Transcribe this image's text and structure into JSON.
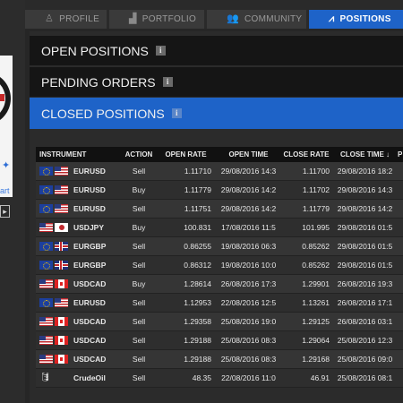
{
  "left": {
    "link_fragment": "art",
    "arrow_glyph": "▸"
  },
  "tabs": [
    {
      "label": "PROFILE",
      "icon": "profile-icon"
    },
    {
      "label": "PORTFOLIO",
      "icon": "portfolio-chart-icon"
    },
    {
      "label": "COMMUNITY",
      "icon": "community-icon"
    },
    {
      "label": "POSITIONS",
      "icon": "positions-icon",
      "active": true
    }
  ],
  "sections": {
    "open": "OPEN POSITIONS",
    "pending": "PENDING ORDERS",
    "closed": "CLOSED POSITIONS"
  },
  "info_glyph": "i",
  "table": {
    "headers": [
      "INSTRUMENT",
      "ACTION",
      "OPEN RATE",
      "OPEN TIME",
      "CLOSE RATE",
      "CLOSE TIME ↓",
      "P"
    ],
    "rows": [
      {
        "flags": [
          "eu",
          "us"
        ],
        "symbol": "EURUSD",
        "action": "Sell",
        "open_rate": "1.11710",
        "open_time": "29/08/2016 14:3",
        "close_rate": "1.11700",
        "close_time": "29/08/2016 18:2"
      },
      {
        "flags": [
          "eu",
          "us"
        ],
        "symbol": "EURUSD",
        "action": "Buy",
        "open_rate": "1.11779",
        "open_time": "29/08/2016 14:2",
        "close_rate": "1.11702",
        "close_time": "29/08/2016 14:3"
      },
      {
        "flags": [
          "eu",
          "us"
        ],
        "symbol": "EURUSD",
        "action": "Sell",
        "open_rate": "1.11751",
        "open_time": "29/08/2016 14:2",
        "close_rate": "1.11779",
        "close_time": "29/08/2016 14:2"
      },
      {
        "flags": [
          "us",
          "jp"
        ],
        "symbol": "USDJPY",
        "action": "Buy",
        "open_rate": "100.831",
        "open_time": "17/08/2016 11:5",
        "close_rate": "101.995",
        "close_time": "29/08/2016 01:5"
      },
      {
        "flags": [
          "eu",
          "gb"
        ],
        "symbol": "EURGBP",
        "action": "Sell",
        "open_rate": "0.86255",
        "open_time": "19/08/2016 06:3",
        "close_rate": "0.85262",
        "close_time": "29/08/2016 01:5"
      },
      {
        "flags": [
          "eu",
          "gb"
        ],
        "symbol": "EURGBP",
        "action": "Sell",
        "open_rate": "0.86312",
        "open_time": "19/08/2016 10:0",
        "close_rate": "0.85262",
        "close_time": "29/08/2016 01:5"
      },
      {
        "flags": [
          "us",
          "ca"
        ],
        "symbol": "USDCAD",
        "action": "Buy",
        "open_rate": "1.28614",
        "open_time": "26/08/2016 17:3",
        "close_rate": "1.29901",
        "close_time": "26/08/2016 19:3"
      },
      {
        "flags": [
          "eu",
          "us"
        ],
        "symbol": "EURUSD",
        "action": "Sell",
        "open_rate": "1.12953",
        "open_time": "22/08/2016 12:5",
        "close_rate": "1.13261",
        "close_time": "26/08/2016 17:1"
      },
      {
        "flags": [
          "us",
          "ca"
        ],
        "symbol": "USDCAD",
        "action": "Sell",
        "open_rate": "1.29358",
        "open_time": "25/08/2016 19:0",
        "close_rate": "1.29125",
        "close_time": "26/08/2016 03:1"
      },
      {
        "flags": [
          "us",
          "ca"
        ],
        "symbol": "USDCAD",
        "action": "Sell",
        "open_rate": "1.29188",
        "open_time": "25/08/2016 08:3",
        "close_rate": "1.29064",
        "close_time": "25/08/2016 12:3"
      },
      {
        "flags": [
          "us",
          "ca"
        ],
        "symbol": "USDCAD",
        "action": "Sell",
        "open_rate": "1.29188",
        "open_time": "25/08/2016 08:3",
        "close_rate": "1.29168",
        "close_time": "25/08/2016 09:0"
      },
      {
        "flags": [
          "oil"
        ],
        "symbol": "CrudeOil",
        "action": "Sell",
        "open_rate": "48.35",
        "open_time": "22/08/2016 11:0",
        "close_rate": "46.91",
        "close_time": "25/08/2016 08:1"
      }
    ]
  },
  "colors": {
    "accent": "#1e63c8",
    "header_bg": "#151515",
    "row_odd": "#353535",
    "row_even": "#2e2e2e"
  }
}
